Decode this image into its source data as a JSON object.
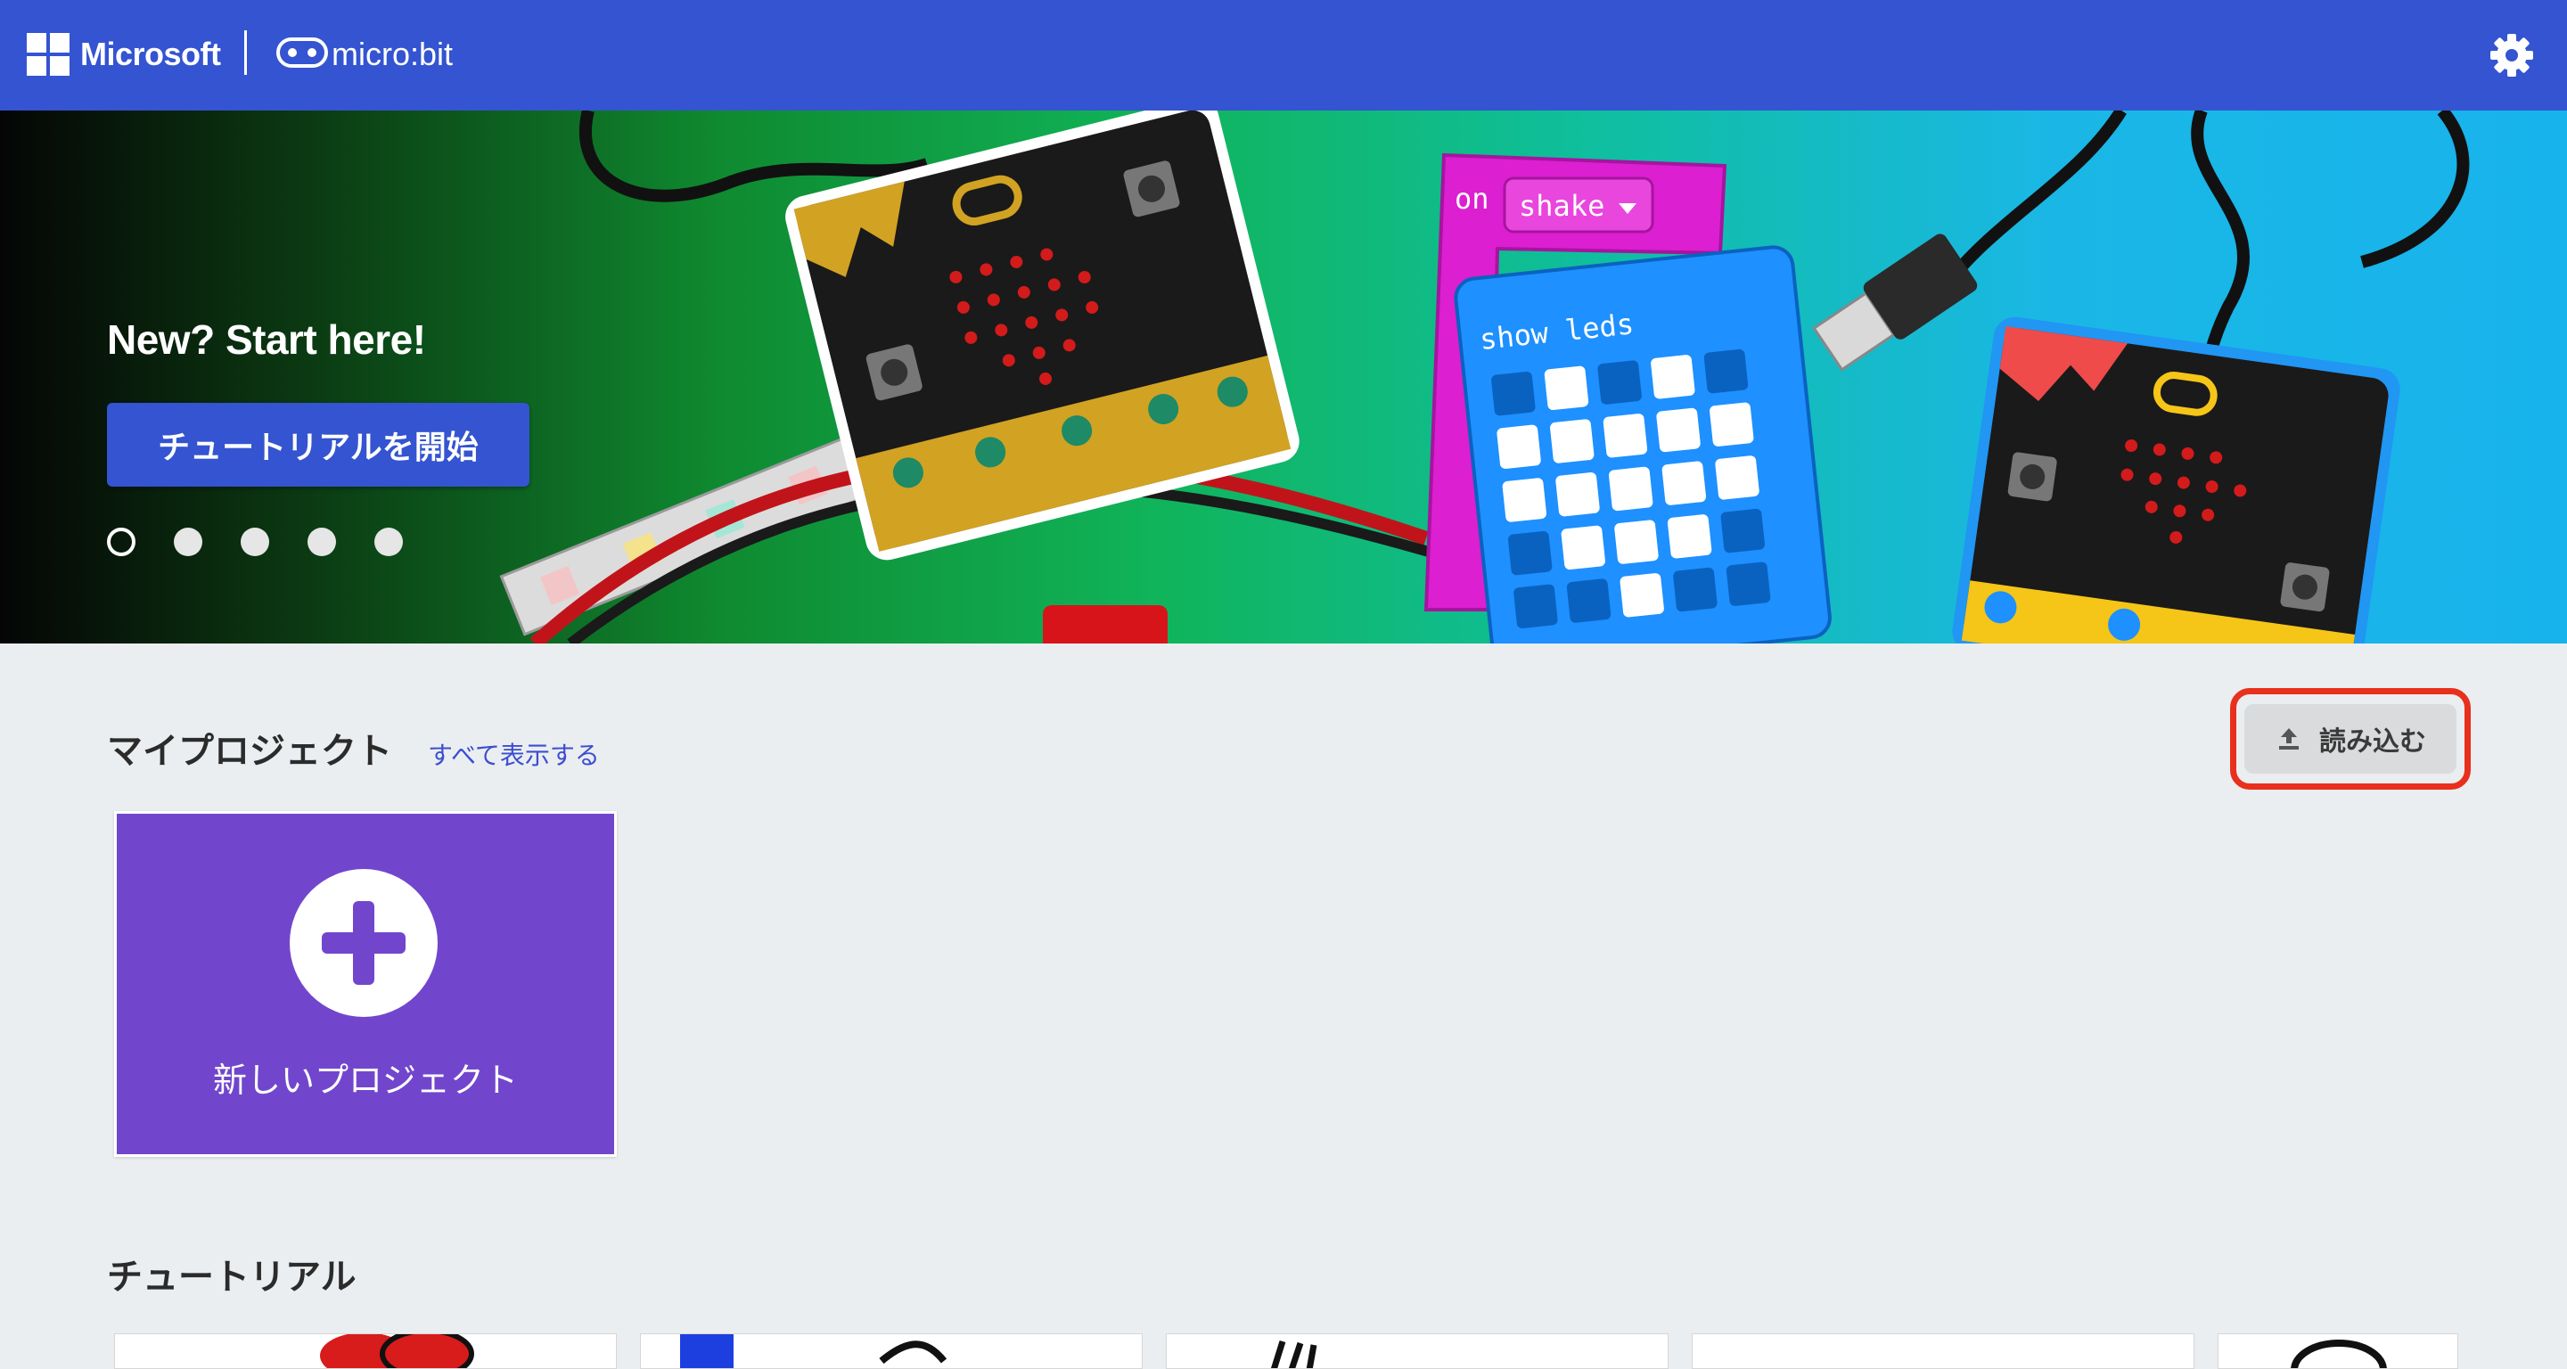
{
  "header": {
    "brand": "Microsoft",
    "product": "micro:bit",
    "settings_icon": "gear-icon"
  },
  "hero": {
    "heading": "New? Start here!",
    "button_label": "チュートリアルを開始",
    "slide_count": 5,
    "active_slide": 1,
    "art": {
      "block_event": "on",
      "block_event_value": "shake",
      "block_body": "show leds"
    }
  },
  "projects": {
    "title": "マイプロジェクト",
    "see_all": "すべて表示する",
    "import_label": "読み込む",
    "import_icon": "upload-icon",
    "new_project_label": "新しいプロジェクト"
  },
  "tutorials": {
    "title": "チュートリアル"
  },
  "colors": {
    "header": "#3454d1",
    "primary_button": "#3454d1",
    "new_project_card": "#7146cd",
    "highlight_outline": "#e8301c",
    "page_background": "#ebeef0"
  }
}
